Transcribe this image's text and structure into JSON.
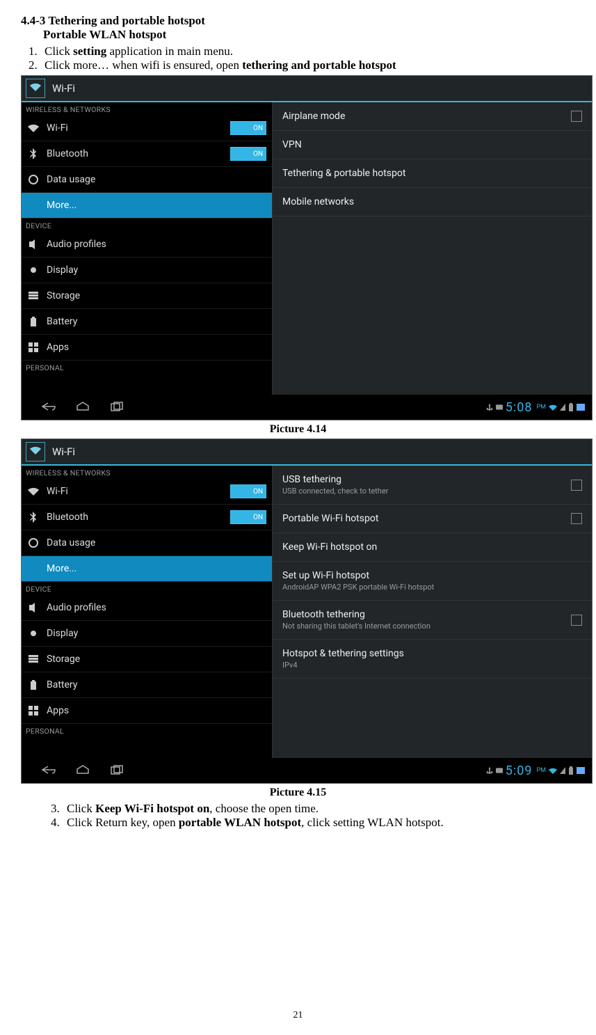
{
  "heading": "4.4-3 Tethering and portable hotspot",
  "subheading": "Portable WLAN hotspot",
  "steps_a": [
    {
      "pre": "Click ",
      "b": "setting",
      "post": " application in main menu."
    },
    {
      "pre": "Click more… when wifi is ensured, open ",
      "b": "tethering and portable hotspot",
      "post": ""
    }
  ],
  "caption1": "Picture 4.14",
  "caption2": "Picture 4.15",
  "steps_b": [
    {
      "pre": "Click ",
      "b": "Keep Wi-Fi hotspot on",
      "post": ", choose the open time."
    },
    {
      "pre": "Click Return key, open ",
      "b": "portable WLAN hotspot",
      "post": ", click setting WLAN hotspot."
    }
  ],
  "pagenum": "21",
  "shotCommon": {
    "title": "Wi-Fi",
    "section_wn": "WIRELESS & NETWORKS",
    "section_dev": "DEVICE",
    "section_pers": "PERSONAL",
    "sidebar": {
      "wifi": "Wi-Fi",
      "bt": "Bluetooth",
      "on": "ON",
      "data": "Data usage",
      "more": "More...",
      "audio": "Audio profiles",
      "display": "Display",
      "storage": "Storage",
      "battery": "Battery",
      "apps": "Apps"
    }
  },
  "shot1": {
    "content": [
      {
        "t": "Airplane mode",
        "chk": true
      },
      {
        "t": "VPN"
      },
      {
        "t": "Tethering & portable hotspot"
      },
      {
        "t": "Mobile networks"
      }
    ],
    "time": "5:08",
    "ampm": "PM"
  },
  "shot2": {
    "content": [
      {
        "t": "USB tethering",
        "s": "USB connected, check to tether",
        "chk": true
      },
      {
        "t": "Portable Wi-Fi hotspot",
        "chk": true
      },
      {
        "t": "Keep Wi-Fi hotspot on"
      },
      {
        "t": "Set up Wi-Fi hotspot",
        "s": "AndroidAP WPA2 PSK portable Wi-Fi hotspot"
      },
      {
        "t": "Bluetooth tethering",
        "s": "Not sharing this tablet's Internet connection",
        "chk": true
      },
      {
        "t": "Hotspot & tethering settings",
        "s": "IPv4"
      }
    ],
    "time": "5:09",
    "ampm": "PM"
  }
}
